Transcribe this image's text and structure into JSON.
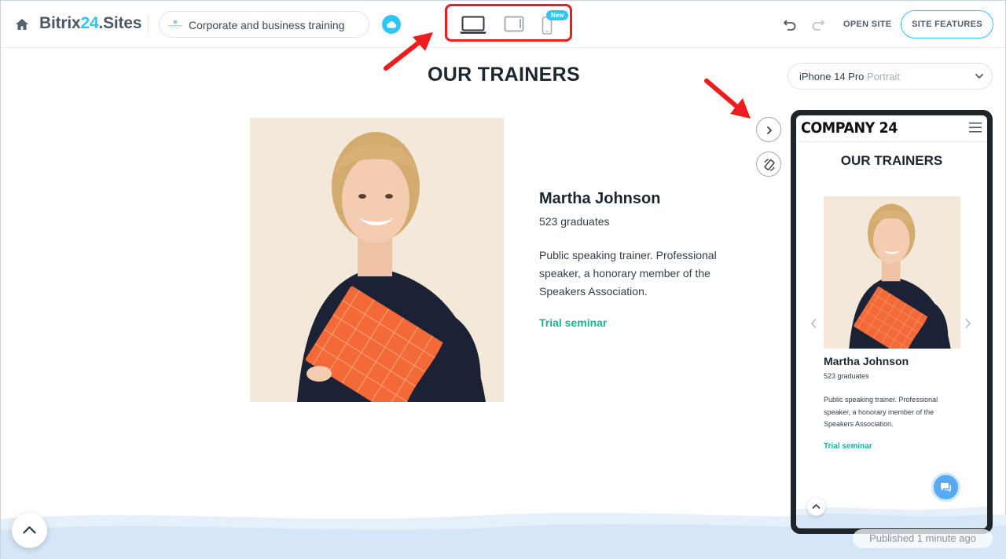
{
  "topbar": {
    "logo_prefix": "Bitrix",
    "logo_number": "24",
    "logo_suffix": ".Sites",
    "site_name": "Corporate and business training",
    "device_new_badge": "New",
    "open_site": "OPEN SITE",
    "site_features": "SITE FEATURES"
  },
  "section": {
    "title": "OUR TRAINERS"
  },
  "trainer": {
    "name": "Martha Johnson",
    "graduates": "523 graduates",
    "description": "Public speaking trainer. Professional speaker, a honorary member of the Speakers Association.",
    "link": "Trial seminar"
  },
  "preview": {
    "device_model": "iPhone 14 Pro",
    "device_orientation": "Portrait",
    "mobile": {
      "brand": "COMPANY 24",
      "title": "OUR TRAINERS",
      "name": "Martha Johnson",
      "graduates": "523 graduates",
      "description": "Public speaking trainer. Professional speaker, a honorary member of the Speakers Association.",
      "link": "Trial seminar"
    }
  },
  "status": {
    "published": "Published 1 minute ago"
  },
  "colors": {
    "accent": "#2fc6f6",
    "link": "#17b29a",
    "highlight": "#ee1c1c"
  },
  "icons": [
    "home-icon",
    "cloud-icon",
    "desktop-icon",
    "tablet-icon",
    "phone-icon",
    "undo-icon",
    "redo-icon",
    "chevron-down-icon",
    "chevron-right-icon",
    "rotate-icon",
    "menu-icon",
    "chat-icon",
    "arrow-up-icon"
  ]
}
